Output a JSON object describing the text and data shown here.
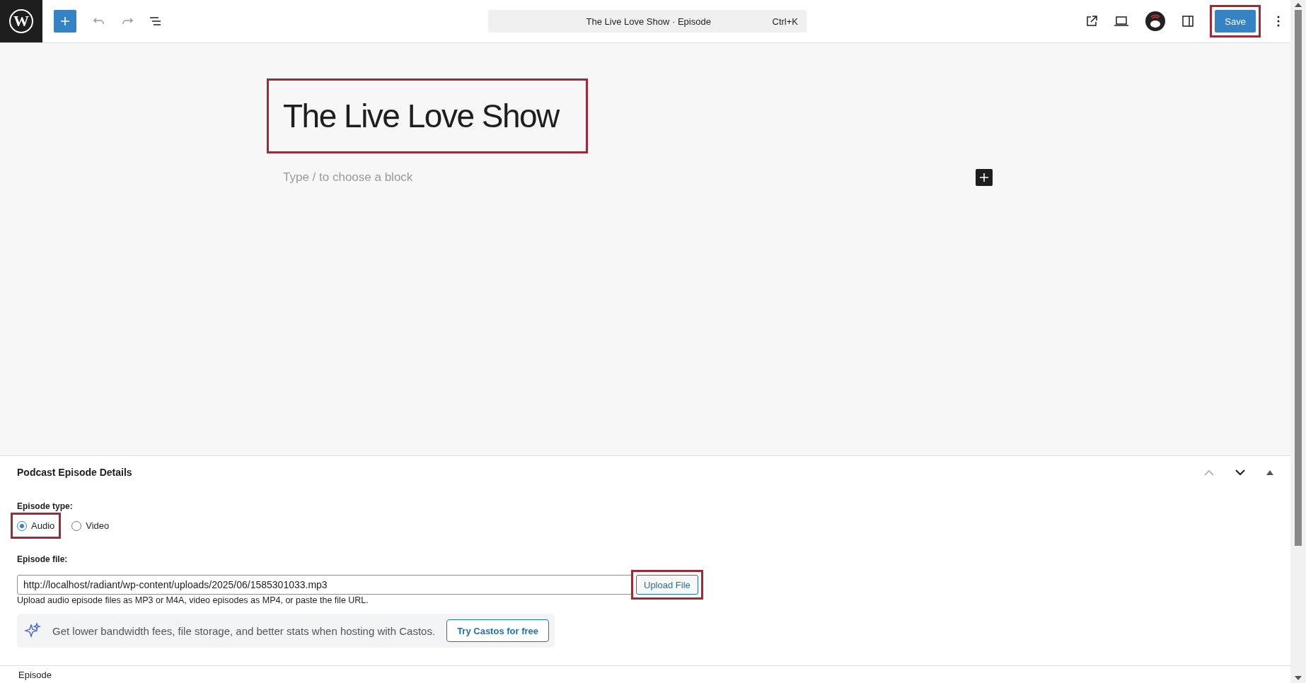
{
  "toolbar": {
    "logo": "W",
    "command_bar": {
      "title": "The Live Love Show · Episode",
      "shortcut": "Ctrl+K"
    },
    "save": {
      "label": "Save",
      "highlighted": true
    }
  },
  "editor": {
    "title": {
      "text": "The Live Love Show",
      "highlighted": true
    },
    "placeholder": "Type / to choose a block"
  },
  "panel": {
    "title": "Podcast Episode Details",
    "episode_type": {
      "label": "Episode type:",
      "options": [
        {
          "label": "Audio",
          "selected": true,
          "highlighted": true
        },
        {
          "label": "Video",
          "selected": false,
          "highlighted": false
        }
      ]
    },
    "episode_file": {
      "label": "Episode file:",
      "value": "http://localhost/radiant/wp-content/uploads/2025/06/1585301033.mp3",
      "upload": {
        "label": "Upload File",
        "highlighted": true
      },
      "help": "Upload audio episode files as MP3 or M4A, video episodes as MP4, or paste the file URL."
    },
    "promo": {
      "text": "Get lower bandwidth fees, file storage, and better stats when hosting with Castos.",
      "button": "Try Castos for free"
    }
  },
  "footer": {
    "breadcrumb": "Episode"
  }
}
